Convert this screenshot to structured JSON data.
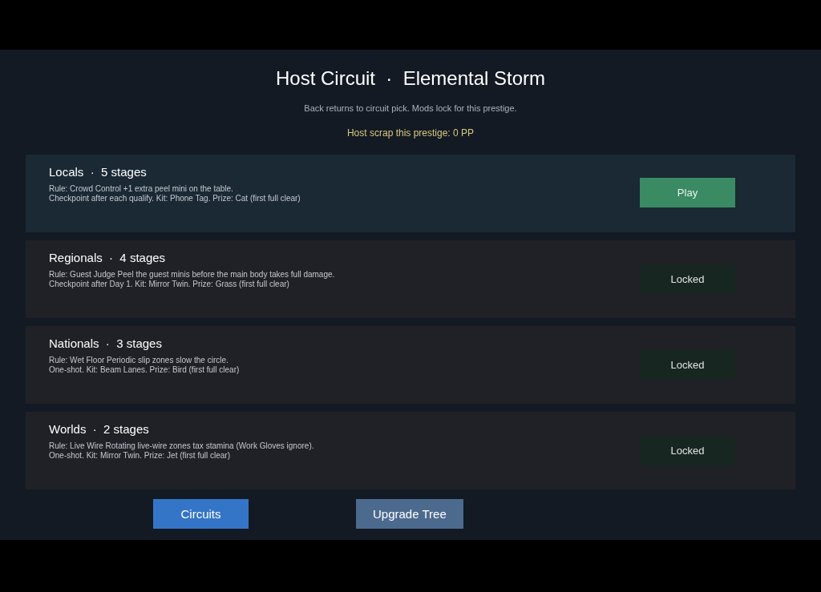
{
  "header": {
    "title": "Host Circuit  ·  Elemental Storm",
    "subtitle": "Back returns to circuit pick. Mods lock for this prestige.",
    "scrap": "Host scrap this prestige: 0 PP"
  },
  "circuits": [
    {
      "title": "Locals  ·  5 stages",
      "rule": "Rule: Crowd Control  +1 extra peel mini on the table.",
      "details": "Checkpoint after each qualify. Kit: Phone Tag. Prize: Cat (first full clear)",
      "unlocked": true,
      "button": "Play"
    },
    {
      "title": "Regionals  ·  4 stages",
      "rule": "Rule: Guest Judge  Peel the guest minis before the main body takes full damage.",
      "details": "Checkpoint after Day 1. Kit: Mirror Twin. Prize: Grass (first full clear)",
      "unlocked": false,
      "button": "Locked"
    },
    {
      "title": "Nationals  ·  3 stages",
      "rule": "Rule: Wet Floor  Periodic slip zones slow the circle.",
      "details": "One-shot. Kit: Beam Lanes. Prize: Bird (first full clear)",
      "unlocked": false,
      "button": "Locked"
    },
    {
      "title": "Worlds  ·  2 stages",
      "rule": "Rule: Live Wire  Rotating live-wire zones tax stamina (Work Gloves ignore).",
      "details": "One-shot. Kit: Mirror Twin. Prize: Jet (first full clear)",
      "unlocked": false,
      "button": "Locked"
    }
  ],
  "footer_buttons": [
    {
      "label": "Circuits",
      "kind": "primary"
    },
    {
      "label": "Upgrade Tree",
      "kind": "secondary"
    }
  ]
}
